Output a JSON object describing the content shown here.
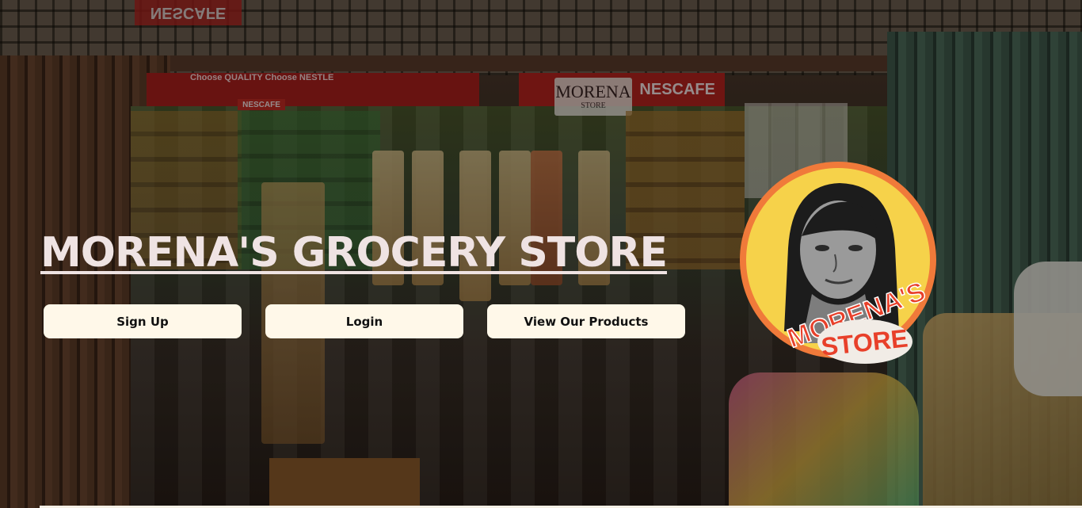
{
  "hero": {
    "title": "MORENA'S GROCERY STORE"
  },
  "buttons": {
    "signup_label": "Sign Up",
    "login_label": "Login",
    "products_label": "View Our Products"
  },
  "logo": {
    "line1": "MORENA'S",
    "line2": "STORE"
  },
  "background_signs": {
    "nescafe_top": "NESCAFE",
    "nestle_banner": "Choose QUALITY Choose NESTLE",
    "nescafe_left": "NESCAFE",
    "nescafe_right": "NESCAFE",
    "store_sign_line1": "MORENA",
    "store_sign_line2": "STORE"
  },
  "colors": {
    "title_text": "#efe3e3",
    "button_bg": "#fff8e9",
    "button_text": "#111111",
    "logo_ring": "#f07a3a",
    "logo_fill": "#f6d24a",
    "logo_text": "#e8402a"
  }
}
